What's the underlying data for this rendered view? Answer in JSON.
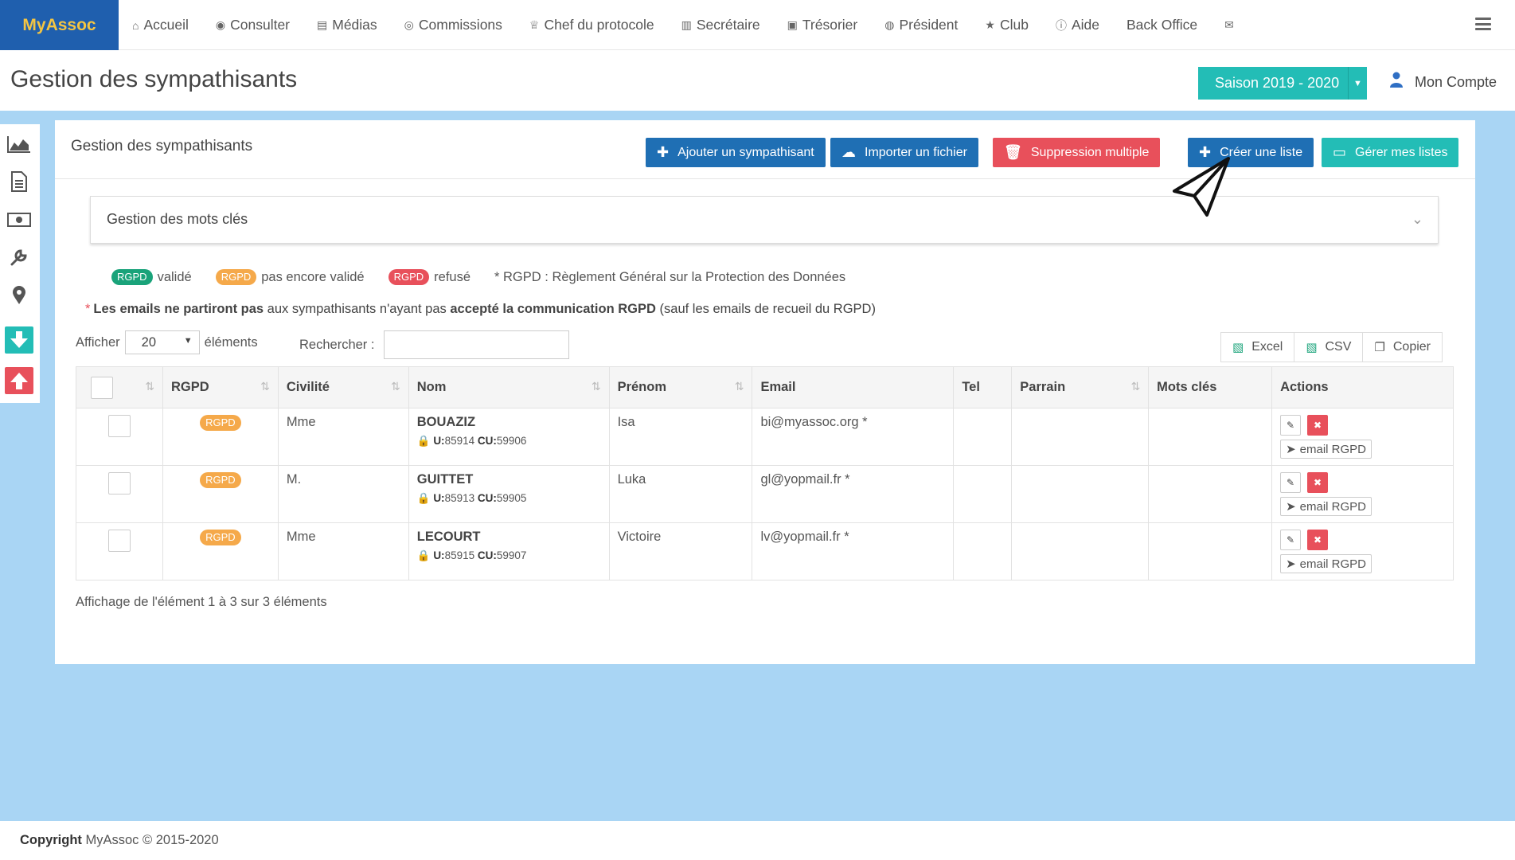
{
  "brand": "MyAssoc",
  "nav": {
    "items": [
      {
        "label": "Accueil",
        "icon": "home-icon",
        "glyph": "⌂"
      },
      {
        "label": "Consulter",
        "icon": "eye-icon",
        "glyph": "◉"
      },
      {
        "label": "Médias",
        "icon": "file-icon",
        "glyph": "▤"
      },
      {
        "label": "Commissions",
        "icon": "users-icon",
        "glyph": "◎"
      },
      {
        "label": "Chef du protocole",
        "icon": "trophy-icon",
        "glyph": "♕"
      },
      {
        "label": "Secrétaire",
        "icon": "book-icon",
        "glyph": "▥"
      },
      {
        "label": "Trésorier",
        "icon": "money-icon",
        "glyph": "▣"
      },
      {
        "label": "Président",
        "icon": "globe-icon",
        "glyph": "◍"
      },
      {
        "label": "Club",
        "icon": "star-icon",
        "glyph": "★"
      },
      {
        "label": "Aide",
        "icon": "info-icon",
        "glyph": "ⓘ"
      },
      {
        "label": "Back Office",
        "icon": "",
        "glyph": ""
      },
      {
        "label": "",
        "icon": "envelope-icon",
        "glyph": "✉"
      }
    ]
  },
  "header": {
    "title": "Gestion des sympathisants",
    "season": "Saison 2019 - 2020",
    "account": "Mon Compte"
  },
  "card": {
    "title": "Gestion des sympathisants",
    "buttons": {
      "add": "Ajouter un sympathisant",
      "import": "Importer un fichier",
      "multi_delete": "Suppression multiple",
      "create_list": "Créer une liste",
      "manage_lists": "Gérer mes listes"
    },
    "keywords_title": "Gestion des mots clés"
  },
  "legend": {
    "badge": "RGPD",
    "valid": "validé",
    "pending": "pas encore validé",
    "refused": "refusé",
    "footnote": "* RGPD : Règlement Général sur la Protection des Données"
  },
  "note": {
    "star": "*",
    "bold1": "Les emails ne partiront pas",
    "mid": " aux sympathisants n'ayant pas ",
    "bold2": "accepté la communication RGPD",
    "end": " (sauf les emails de recueil du RGPD)"
  },
  "controls": {
    "afficher": "Afficher",
    "page_size": "20",
    "elements": "éléments",
    "search_label": "Rechercher :",
    "search_value": "",
    "excel": "Excel",
    "csv": "CSV",
    "copy": "Copier"
  },
  "table": {
    "headers": [
      "",
      "RGPD",
      "Civilité",
      "Nom",
      "Prénom",
      "Email",
      "Tel",
      "Parrain",
      "Mots clés",
      "Actions"
    ],
    "rows": [
      {
        "rgpd": "RGPD",
        "civilite": "Mme",
        "nom": "BOUAZIZ",
        "u": "85914",
        "cu": "59906",
        "prenom": "Isa",
        "email": "bi@myassoc.org *",
        "tel": "",
        "parrain": "",
        "mots": ""
      },
      {
        "rgpd": "RGPD",
        "civilite": "M.",
        "nom": "GUITTET",
        "u": "85913",
        "cu": "59905",
        "prenom": "Luka",
        "email": "gl@yopmail.fr *",
        "tel": "",
        "parrain": "",
        "mots": ""
      },
      {
        "rgpd": "RGPD",
        "civilite": "Mme",
        "nom": "LECOURT",
        "u": "85915",
        "cu": "59907",
        "prenom": "Victoire",
        "email": "lv@yopmail.fr *",
        "tel": "",
        "parrain": "",
        "mots": ""
      }
    ],
    "u_label": "U:",
    "cu_label": "CU:",
    "email_rgpd": "email RGPD"
  },
  "info": "Affichage de l'élément 1 à 3 sur 3 éléments",
  "footer": {
    "bold": "Copyright",
    "text": " MyAssoc © 2015-2020"
  }
}
